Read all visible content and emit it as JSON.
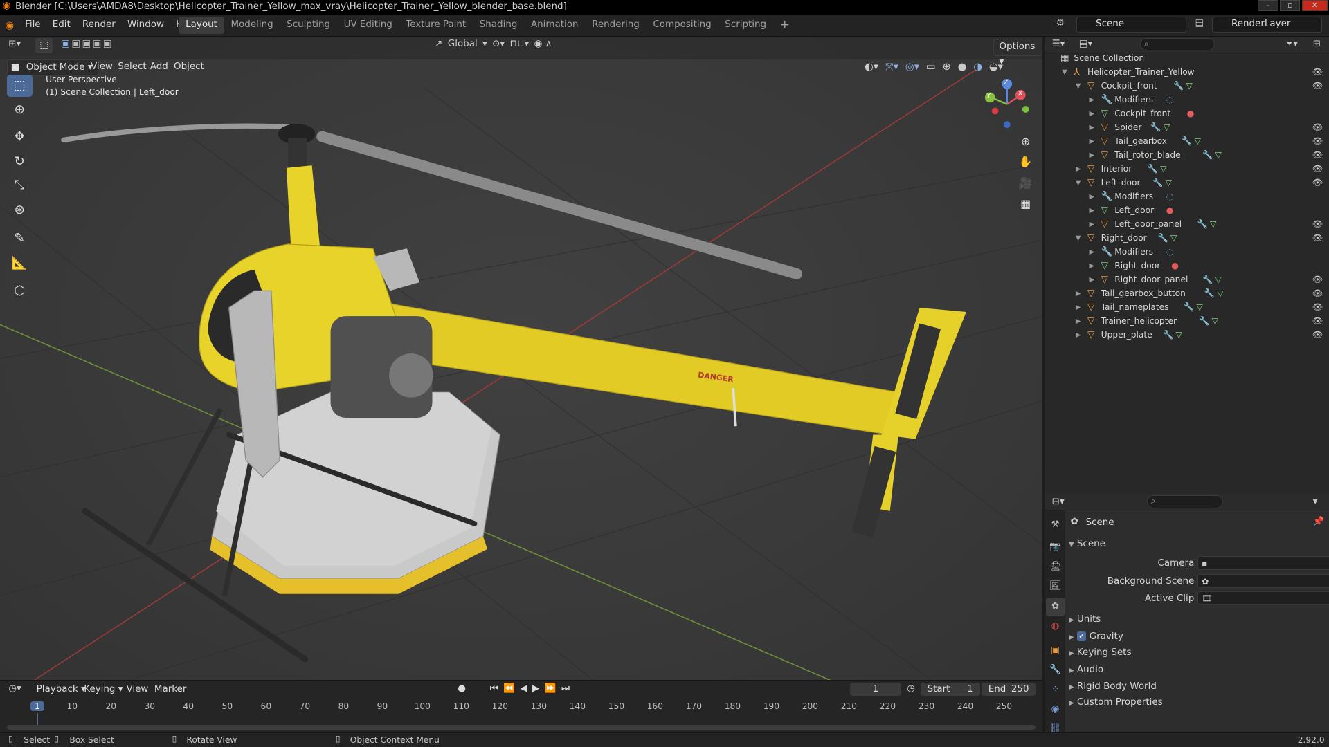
{
  "window": {
    "title": "Blender [C:\\Users\\AMDA8\\Desktop\\Helicopter_Trainer_Yellow_max_vray\\Helicopter_Trainer_Yellow_blender_base.blend]"
  },
  "menu": [
    "File",
    "Edit",
    "Render",
    "Window",
    "Help"
  ],
  "workspaces": [
    "Layout",
    "Modeling",
    "Sculpting",
    "UV Editing",
    "Texture Paint",
    "Shading",
    "Animation",
    "Rendering",
    "Compositing",
    "Scripting"
  ],
  "scene_field": "Scene",
  "renderlayer_field": "RenderLayer",
  "viewport": {
    "mode": "Object Mode",
    "menus": [
      "View",
      "Select",
      "Add",
      "Object"
    ],
    "transform_orientation": "Global",
    "options_label": "Options",
    "overlay_title": "User Perspective",
    "overlay_sub": "(1) Scene Collection | Left_door",
    "decal_text": "DANGER",
    "gizmo": {
      "z": "Z",
      "x": "X",
      "y": "Y"
    }
  },
  "outliner": {
    "root": "Scene Collection",
    "items": [
      {
        "label": "Helicopter_Trainer_Yellow",
        "depth": 0
      },
      {
        "label": "Cockpit_front",
        "depth": 1
      },
      {
        "label": "Modifiers",
        "depth": 2
      },
      {
        "label": "Cockpit_front",
        "depth": 2
      },
      {
        "label": "Spider",
        "depth": 2
      },
      {
        "label": "Tail_gearbox",
        "depth": 2
      },
      {
        "label": "Tail_rotor_blade",
        "depth": 2
      },
      {
        "label": "Interior",
        "depth": 1
      },
      {
        "label": "Left_door",
        "depth": 1
      },
      {
        "label": "Modifiers",
        "depth": 2
      },
      {
        "label": "Left_door",
        "depth": 2
      },
      {
        "label": "Left_door_panel",
        "depth": 2
      },
      {
        "label": "Right_door",
        "depth": 1
      },
      {
        "label": "Modifiers",
        "depth": 2
      },
      {
        "label": "Right_door",
        "depth": 2
      },
      {
        "label": "Right_door_panel",
        "depth": 2
      },
      {
        "label": "Tail_gearbox_button",
        "depth": 1
      },
      {
        "label": "Tail_nameplates",
        "depth": 1
      },
      {
        "label": "Trainer_helicopter",
        "depth": 1
      },
      {
        "label": "Upper_plate",
        "depth": 1
      }
    ]
  },
  "properties": {
    "context": "Scene",
    "panel": "Scene",
    "camera_label": "Camera",
    "background_scene_label": "Background Scene",
    "active_clip_label": "Active Clip",
    "sections": [
      "Units",
      "Gravity",
      "Keying Sets",
      "Audio",
      "Rigid Body World",
      "Custom Properties"
    ],
    "gravity_checked": true
  },
  "timeline": {
    "menus": [
      "Playback",
      "Keying",
      "View",
      "Marker"
    ],
    "current_frame": "1",
    "start_label": "Start",
    "start": "1",
    "end_label": "End",
    "end": "250",
    "ticks": [
      "1",
      "10",
      "20",
      "30",
      "40",
      "50",
      "60",
      "70",
      "80",
      "90",
      "100",
      "110",
      "120",
      "130",
      "140",
      "150",
      "160",
      "170",
      "180",
      "190",
      "200",
      "210",
      "220",
      "230",
      "240",
      "250"
    ],
    "current_frame_value": 1
  },
  "status": {
    "select": "Select",
    "box_select": "Box Select",
    "rotate_view": "Rotate View",
    "context_menu": "Object Context Menu",
    "version": "2.92.0"
  },
  "colors": {
    "accent": "#4b6a98",
    "helicopter": "#e8d32a",
    "object_icon": "#e99a40"
  }
}
